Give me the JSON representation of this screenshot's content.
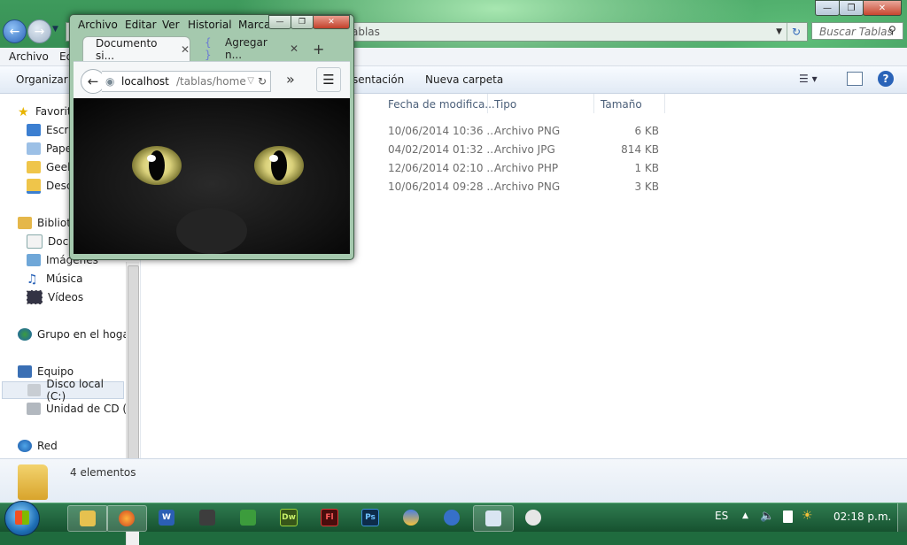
{
  "explorer": {
    "address_text": "ablas",
    "search_placeholder": "Buscar Tablas",
    "menu": [
      "Archivo",
      "Ed"
    ],
    "commands": {
      "organize": "Organizar",
      "presentation": "sentación",
      "new_folder": "Nueva carpeta"
    },
    "nav_tree": {
      "favorites": "Favorit",
      "favorites_items": [
        "Escri",
        "Pape",
        "Geek",
        "Desc"
      ],
      "libraries": "Bibliot",
      "libraries_items": [
        "Docu",
        "Imágenes",
        "Música",
        "Vídeos"
      ],
      "homegroup": "Grupo en el hogar",
      "computer": "Equipo",
      "computer_items": [
        "Disco local (C:)",
        "Unidad de CD (D"
      ],
      "network": "Red"
    },
    "columns": {
      "date": "Fecha de modifica...",
      "type": "Tipo",
      "size": "Tamaño"
    },
    "files": [
      {
        "date": "10/06/2014 10:36 ...",
        "type": "Archivo PNG",
        "size": "6 KB"
      },
      {
        "date": "04/02/2014 01:32 ...",
        "type": "Archivo JPG",
        "size": "814 KB"
      },
      {
        "date": "12/06/2014 02:10 ...",
        "type": "Archivo PHP",
        "size": "1 KB"
      },
      {
        "date": "10/06/2014 09:28 ...",
        "type": "Archivo PNG",
        "size": "3 KB"
      }
    ],
    "status": "4 elementos"
  },
  "firefox": {
    "menu": [
      "Archivo",
      "Editar",
      "Ver",
      "Historial",
      "Marcad"
    ],
    "tabs": [
      {
        "label": "Documento si..."
      },
      {
        "label": "Agregar n..."
      }
    ],
    "url_host": "localhost",
    "url_path": "/tablas/home"
  },
  "taskbar": {
    "lang": "ES",
    "clock": "02:18 p.m.",
    "apps": [
      "W",
      "Dw",
      "Fl",
      "Ps"
    ]
  },
  "colors": {
    "taskbar": "#16512f",
    "explorer_accent": "#1e3287",
    "firefox_frame": "#a5c9ae"
  }
}
